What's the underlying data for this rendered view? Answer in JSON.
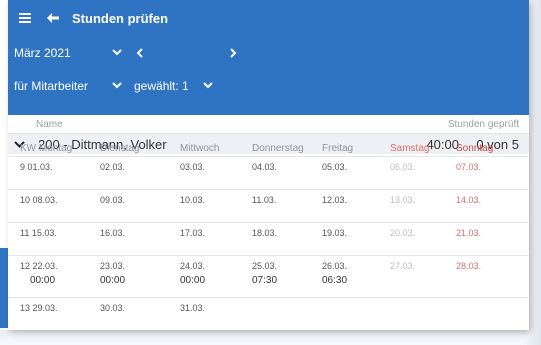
{
  "header": {
    "title": "Stunden prüfen",
    "month": "März 2021",
    "filter_label": "für Mitarbeiter",
    "selected_label": "gewählt: 1"
  },
  "table": {
    "names_header": "Name",
    "checked_header": "Stunden geprüft",
    "person": {
      "name": "200 - Dittmann, Volker",
      "hours": "40:00",
      "count": "0 von 5"
    },
    "columns": [
      "KW Montag",
      "Dienstag",
      "Mittwoch",
      "Donnerstag",
      "Freitag",
      "Samstag",
      "Sonntag"
    ],
    "rows": [
      {
        "cells": [
          "9 01.03.",
          "02.03.",
          "03.03.",
          "04.03.",
          "05.03.",
          "06.03.",
          "07.03."
        ],
        "hours": [
          "",
          "",
          "",
          "",
          "",
          "",
          ""
        ]
      },
      {
        "cells": [
          "10 08.03.",
          "09.03.",
          "10.03.",
          "11.03.",
          "12.03.",
          "13.03.",
          "14.03."
        ],
        "hours": [
          "",
          "",
          "",
          "",
          "",
          "",
          ""
        ]
      },
      {
        "cells": [
          "11 15.03.",
          "16.03.",
          "17.03.",
          "18.03.",
          "19.03.",
          "20.03.",
          "21.03."
        ],
        "hours": [
          "",
          "",
          "",
          "",
          "",
          "",
          ""
        ]
      },
      {
        "cells": [
          "12 22.03.",
          "23.03.",
          "24.03.",
          "25.03.",
          "26.03.",
          "27.03.",
          "28.03."
        ],
        "hours": [
          "00:00",
          "00:00",
          "00:00",
          "07:30",
          "06:30",
          "",
          ""
        ]
      },
      {
        "cells": [
          "13 29.03.",
          "30.03.",
          "31.03.",
          "",
          "",
          "",
          ""
        ],
        "hours": [
          "",
          "",
          "",
          "",
          "",
          "",
          ""
        ]
      }
    ]
  },
  "colors": {
    "header_bg": "#2f74c2",
    "sunday": "#d86f6f"
  },
  "icons": [
    "menu-icon",
    "back-arrow-icon",
    "chevron-down-icon",
    "chevron-left-icon",
    "chevron-right-icon"
  ]
}
